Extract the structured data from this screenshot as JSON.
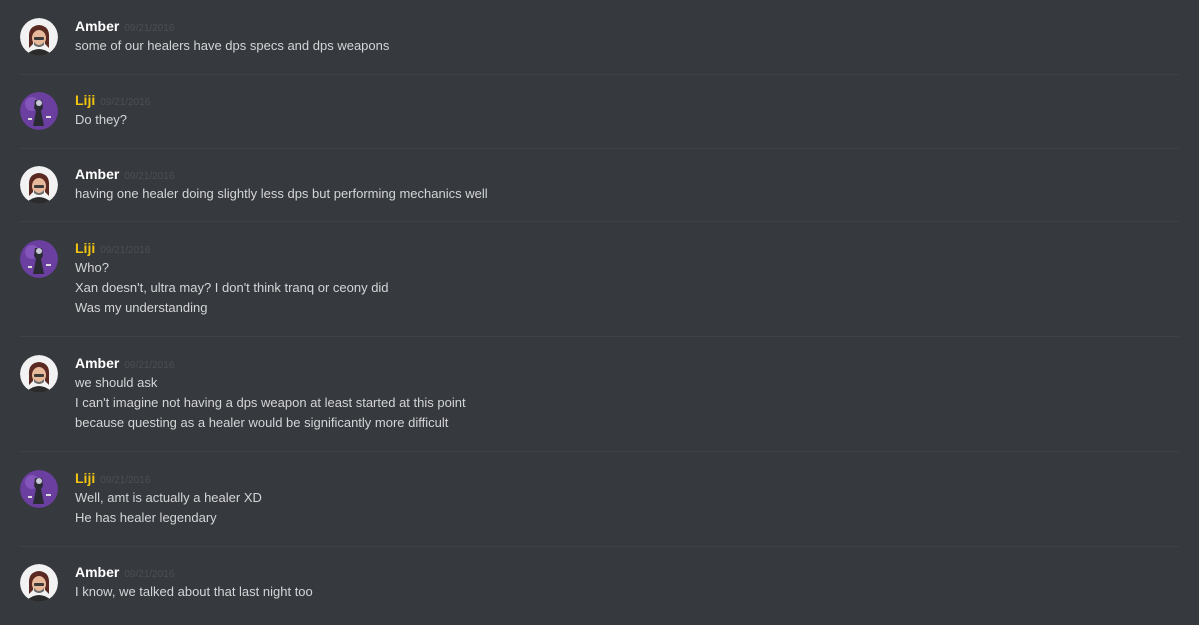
{
  "messages": [
    {
      "author": "Amber",
      "timestamp": "09/21/2016",
      "lines": [
        "some of our healers have dps specs and dps weapons"
      ]
    },
    {
      "author": "Liji",
      "timestamp": "09/21/2016",
      "lines": [
        "Do they?"
      ]
    },
    {
      "author": "Amber",
      "timestamp": "09/21/2016",
      "lines": [
        "having one healer doing slightly less dps but performing mechanics well"
      ]
    },
    {
      "author": "Liji",
      "timestamp": "09/21/2016",
      "lines": [
        "Who?",
        "Xan doesn't, ultra may? I don't think tranq or ceony did",
        "Was my understanding"
      ]
    },
    {
      "author": "Amber",
      "timestamp": "09/21/2016",
      "lines": [
        "we should ask",
        "I can't imagine not having a dps weapon at least started at this point",
        "because questing as a healer would be significantly more difficult"
      ]
    },
    {
      "author": "Liji",
      "timestamp": "09/21/2016",
      "lines": [
        "Well, amt is actually a healer XD",
        "He has healer legendary"
      ]
    },
    {
      "author": "Amber",
      "timestamp": "09/21/2016",
      "lines": [
        "I know, we talked about that last night too"
      ]
    }
  ],
  "colors": {
    "background": "#36393e",
    "amber_name": "#ffffff",
    "liji_name": "#f1c40f",
    "timestamp": "#4c4f55",
    "message_text": "#d4d5d6",
    "divider": "#3e4147"
  },
  "icons": {
    "amber_avatar": "amber-avatar-icon",
    "liji_avatar": "liji-avatar-icon"
  }
}
